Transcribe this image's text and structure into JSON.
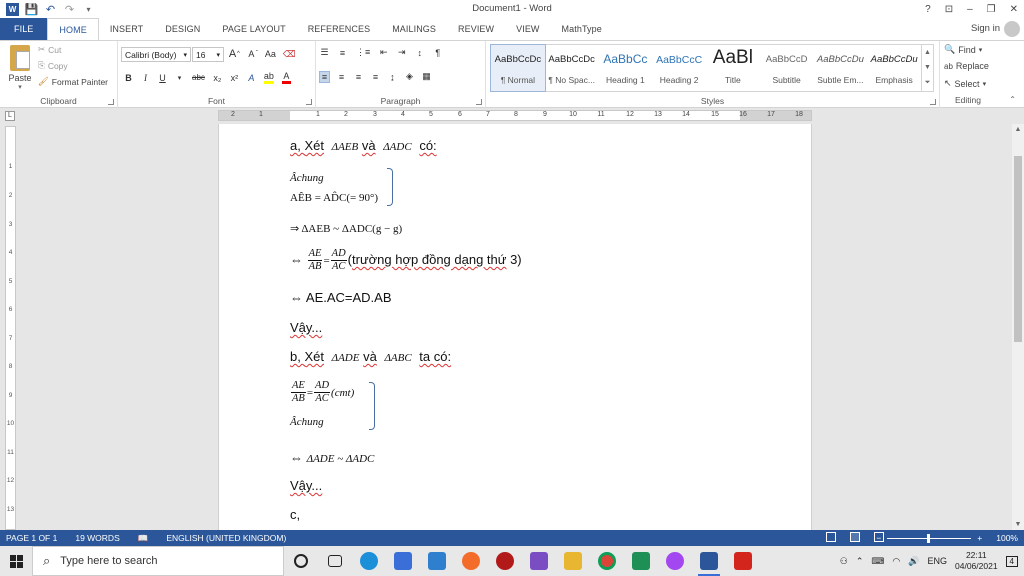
{
  "window": {
    "title": "Document1 - Word",
    "controls": [
      "?",
      "⊡",
      "–",
      "❐",
      "✕"
    ]
  },
  "tabs": [
    "FILE",
    "HOME",
    "INSERT",
    "DESIGN",
    "PAGE LAYOUT",
    "REFERENCES",
    "MAILINGS",
    "REVIEW",
    "VIEW",
    "MathType"
  ],
  "active_tab": "HOME",
  "signin": "Sign in",
  "clipboard": {
    "paste": "Paste",
    "cut": "Cut",
    "copy": "Copy",
    "format_painter": "Format Painter",
    "label": "Clipboard"
  },
  "font": {
    "name": "Calibri (Body)",
    "size": "16",
    "label": "Font",
    "grow": "A",
    "shrink": "A",
    "case": "Aa",
    "bold": "B",
    "italic": "I",
    "underline": "U",
    "strike": "abc",
    "sub": "x₂",
    "sup": "x²",
    "effects": "A",
    "highlight": "ab",
    "color": "A"
  },
  "paragraph": {
    "label": "Paragraph",
    "pilcrow": "¶"
  },
  "styles": {
    "label": "Styles",
    "items": [
      {
        "sample": "AaBbCcDc",
        "name": "¶ Normal"
      },
      {
        "sample": "AaBbCcDc",
        "name": "¶ No Spac..."
      },
      {
        "sample": "AaBbCc",
        "name": "Heading 1"
      },
      {
        "sample": "AaBbCcC",
        "name": "Heading 2"
      },
      {
        "sample": "AaBl",
        "name": "Title"
      },
      {
        "sample": "AaBbCcD",
        "name": "Subtitle"
      },
      {
        "sample": "AaBbCcDu",
        "name": "Subtle Em..."
      },
      {
        "sample": "AaBbCcDu",
        "name": "Emphasis"
      }
    ]
  },
  "editing": {
    "label": "Editing",
    "find": "Find",
    "replace": "Replace",
    "select": "Select"
  },
  "ruler": {
    "numbers": [
      "2",
      "1",
      "1",
      "2",
      "3",
      "4",
      "5",
      "6",
      "7",
      "8",
      "9",
      "10",
      "11",
      "12",
      "13",
      "14",
      "15",
      "16",
      "17",
      "18"
    ],
    "corner": "L"
  },
  "vruler": [
    "1",
    "2",
    "3",
    "4",
    "5",
    "6",
    "7",
    "8",
    "9",
    "10",
    "11",
    "12",
    "13"
  ],
  "document": {
    "a_prefix": "a, ",
    "a_xet": "Xét",
    "a_tri1": "ΔAEB",
    "a_va": "và",
    "a_tri2": "ΔADC",
    "a_co": "có:",
    "a_chung": "Âchung",
    "a_angle": "AÊB = AD̂C(= 90°)",
    "a_similar": "⇒ ΔAEB ~ ΔADC(g − g)",
    "a_imp": "⇔",
    "frac_ae": "AE",
    "frac_ab": "AB",
    "frac_eq": "=",
    "frac_ad": "AD",
    "frac_ac": "AC",
    "a_case_open": "(",
    "a_case": "trường hợp đồng dạng thứ",
    "a_case_close": " 3)",
    "a_product": "⇔ AE.AC=AD.AB",
    "vay1": "Vậy...",
    "b_prefix": "b, ",
    "b_xet": "Xét",
    "b_tri1": "ΔADE",
    "b_va": "và",
    "b_tri2": "ΔABC",
    "b_taco": "ta có:",
    "b_cmt": "(cmt)",
    "b_chung": "Âchung",
    "b_similar_imp": "⇔",
    "b_similar": "ΔADE  ~ ΔADC",
    "vay2": "Vậy...",
    "c_prefix": "c,"
  },
  "status": {
    "page": "PAGE 1 OF 1",
    "words": "19 WORDS",
    "language": "ENGLISH (UNITED KINGDOM)",
    "zoom": "100%",
    "zoom_minus": "−",
    "zoom_plus": "+"
  },
  "taskbar": {
    "search_placeholder": "Type here to search",
    "lang": "ENG",
    "time": "22:11",
    "date": "04/06/2021",
    "notifications": "4"
  },
  "colors": {
    "word_blue": "#2b579a",
    "spell_red": "#d33"
  }
}
